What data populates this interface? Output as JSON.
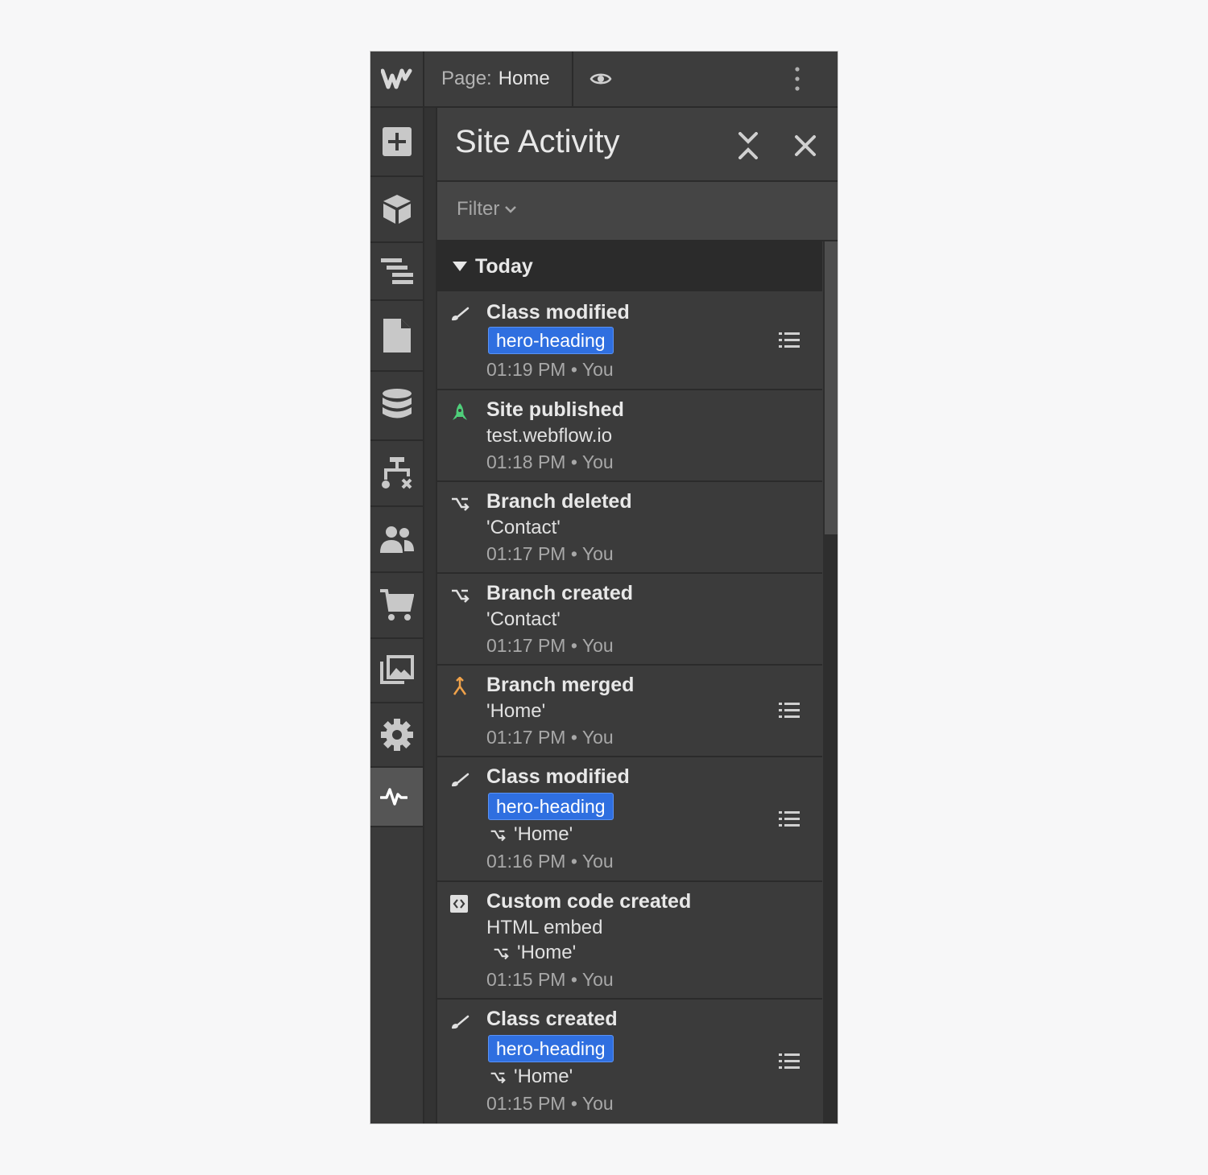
{
  "topbar": {
    "page_prefix": "Page:",
    "page_name": "Home"
  },
  "sidebar": {
    "tools": [
      {
        "name": "add-panel",
        "icon": "plus-square-icon"
      },
      {
        "name": "components",
        "icon": "cube-icon"
      },
      {
        "name": "navigator",
        "icon": "navigator-icon"
      },
      {
        "name": "pages",
        "icon": "page-icon"
      },
      {
        "name": "cms",
        "icon": "database-icon"
      },
      {
        "name": "logic",
        "icon": "flow-icon"
      },
      {
        "name": "users",
        "icon": "users-icon"
      },
      {
        "name": "ecommerce",
        "icon": "cart-icon"
      },
      {
        "name": "assets",
        "icon": "images-icon"
      },
      {
        "name": "settings",
        "icon": "gear-icon"
      },
      {
        "name": "activity",
        "icon": "activity-icon",
        "active": true
      }
    ]
  },
  "panel": {
    "title": "Site Activity",
    "filter_label": "Filter",
    "group_label": "Today",
    "entries": [
      {
        "title": "Class modified",
        "tag": "hero-heading",
        "time": "01:19 PM",
        "author": "You",
        "sep": "•"
      },
      {
        "title": "Site published",
        "detail": "test.webflow.io",
        "time": "01:18 PM",
        "author": "You",
        "sep": "•"
      },
      {
        "title": "Branch deleted",
        "detail": "'Contact'",
        "time": "01:17 PM",
        "author": "You",
        "sep": "•"
      },
      {
        "title": "Branch created",
        "detail": "'Contact'",
        "time": "01:17 PM",
        "author": "You",
        "sep": "•"
      },
      {
        "title": "Branch merged",
        "detail": "'Home'",
        "time": "01:17 PM",
        "author": "You",
        "sep": "•"
      },
      {
        "title": "Class modified",
        "tag": "hero-heading",
        "branch": "'Home'",
        "time": "01:16 PM",
        "author": "You",
        "sep": "•"
      },
      {
        "title": "Custom code created",
        "detail": "HTML embed",
        "branch": "'Home'",
        "time": "01:15 PM",
        "author": "You",
        "sep": "•"
      },
      {
        "title": "Class created",
        "tag": "hero-heading",
        "branch": "'Home'",
        "time": "01:15 PM",
        "author": "You",
        "sep": "•"
      }
    ]
  },
  "colors": {
    "tag_bg": "#2f6fe0",
    "publish_icon": "#4fcf7a",
    "merge_icon": "#f0a24a"
  }
}
